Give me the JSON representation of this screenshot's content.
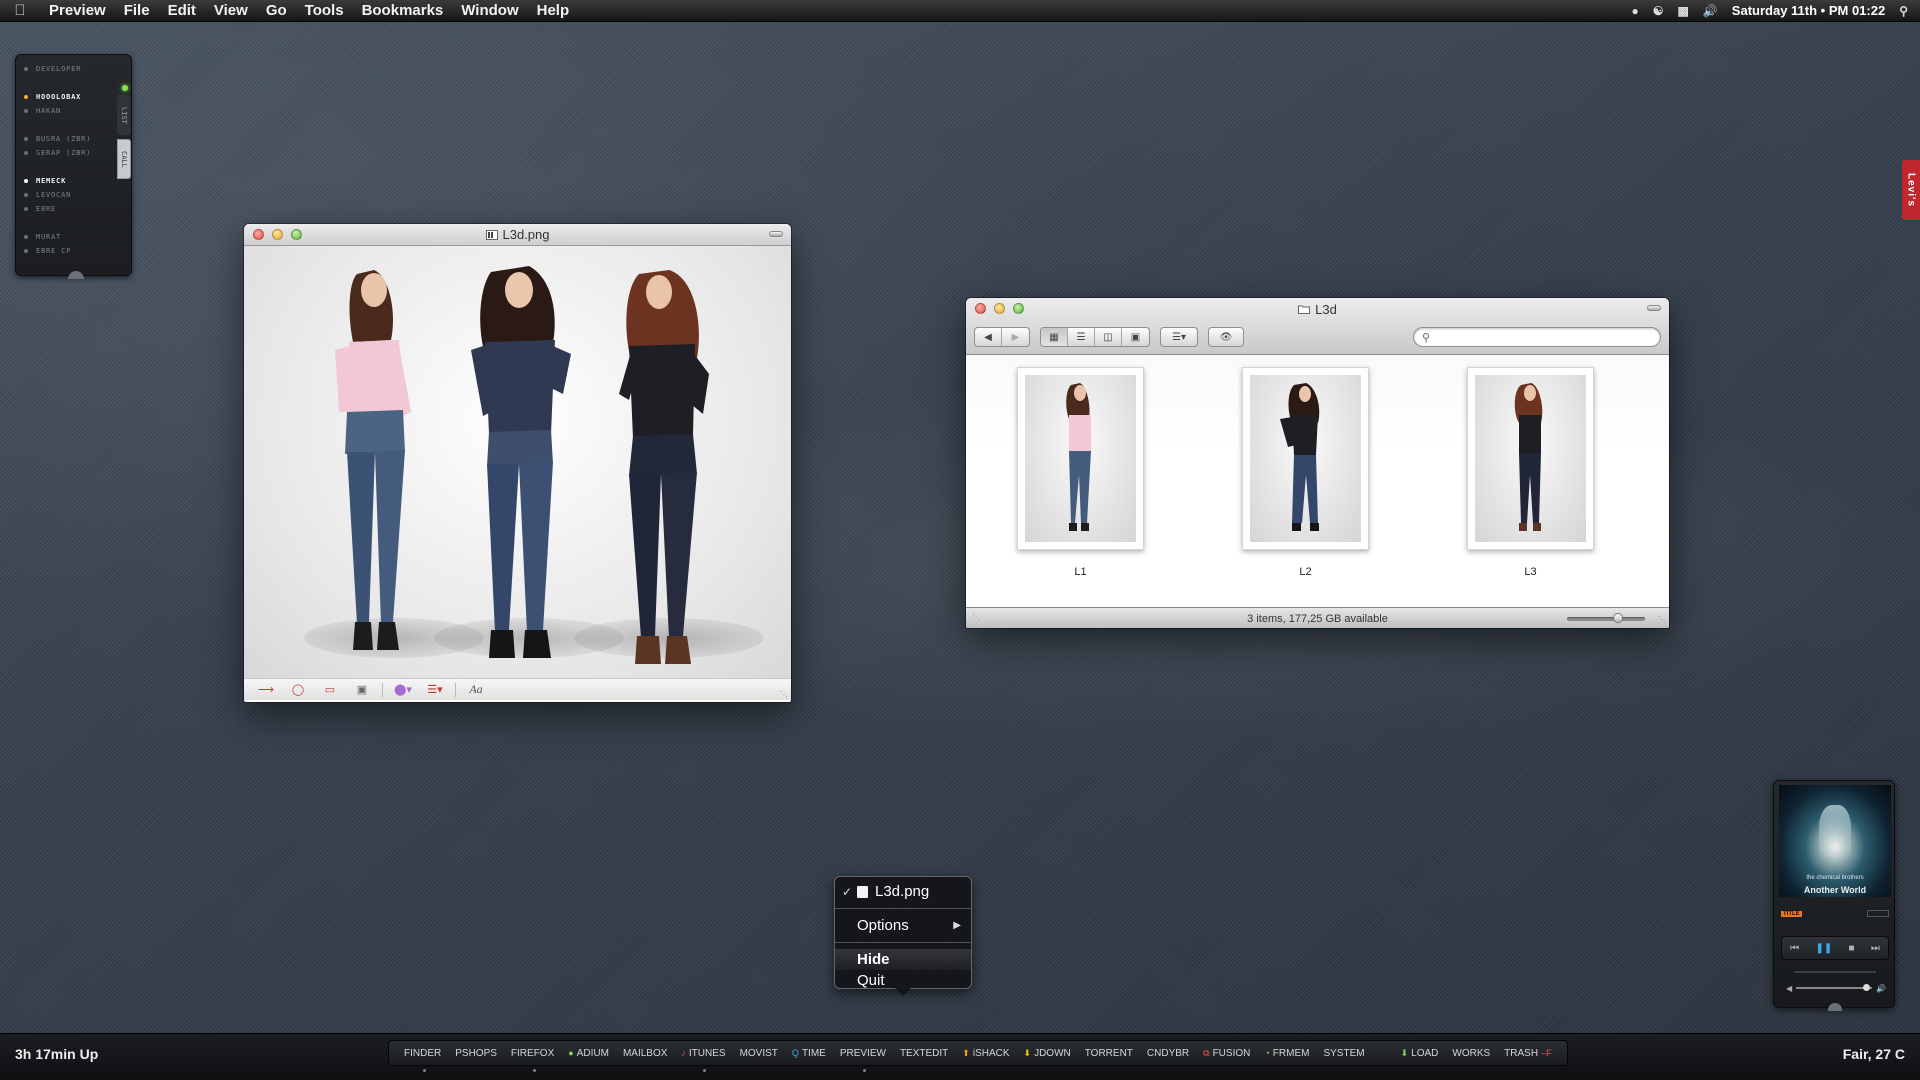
{
  "menubar": {
    "app_name": "Preview",
    "items": [
      "File",
      "Edit",
      "View",
      "Go",
      "Tools",
      "Bookmarks",
      "Window",
      "Help"
    ],
    "clock": "Saturday 11th  •  PM 01:22",
    "status_icons": [
      "chat-icon",
      "network-icon",
      "display-icon",
      "volume-icon",
      "spotlight-icon"
    ]
  },
  "sidebar_widget": {
    "tabs": [
      "LIST",
      "CALL"
    ],
    "groups": [
      [
        {
          "label": "DEVELOPER",
          "state": "normal"
        }
      ],
      [
        {
          "label": "HOOOLOBAX",
          "state": "online"
        },
        {
          "label": "HAKAN",
          "state": "normal"
        }
      ],
      [
        {
          "label": "BUSRA (ZBR)",
          "state": "normal"
        },
        {
          "label": "SERAP (ZBR)",
          "state": "normal"
        }
      ],
      [
        {
          "label": "MEMECK",
          "state": "active"
        },
        {
          "label": "LEVOCAN",
          "state": "normal"
        },
        {
          "label": "EBRE",
          "state": "normal"
        }
      ],
      [
        {
          "label": "MURAT",
          "state": "normal"
        },
        {
          "label": "EBRE CP",
          "state": "normal"
        }
      ]
    ]
  },
  "preview_window": {
    "title": "L3d.png",
    "annotation_tools": [
      "arrow-tool",
      "oval-tool",
      "rectangle-tool",
      "text-box-tool",
      "color-picker",
      "line-style-picker"
    ],
    "font_button": "Aa"
  },
  "finder_window": {
    "title": "L3d",
    "search_placeholder": "",
    "items": [
      {
        "name": "L1"
      },
      {
        "name": "L2"
      },
      {
        "name": "L3"
      }
    ],
    "status": "3 items, 177,25 GB available"
  },
  "dock_menu": {
    "document": "L3d.png",
    "options": "Options",
    "hide": "Hide",
    "quit": "Quit"
  },
  "music_widget": {
    "band": "the chemical brothers",
    "album": "Another World",
    "title_tag": "TITLE"
  },
  "side_tag": "Levi's",
  "bottombar": {
    "uptime": "3h 17min Up",
    "weather": "Fair, 27 C",
    "apps": [
      {
        "label": "FINDER",
        "mark": "",
        "color": "",
        "running": true
      },
      {
        "label": "PSHOPS",
        "mark": "",
        "color": "",
        "running": false
      },
      {
        "label": "FIREFOX",
        "mark": "",
        "color": "",
        "running": true
      },
      {
        "label": "ADIUM",
        "mark": "●",
        "color": "#7ed957",
        "running": false
      },
      {
        "label": "MAILBOX",
        "mark": "",
        "color": "",
        "running": false
      },
      {
        "label": "ITUNES",
        "mark": "♪",
        "color": "#e8574b",
        "running": true
      },
      {
        "label": "MOVIST",
        "mark": "",
        "color": "",
        "running": false
      },
      {
        "label": "TIME",
        "mark": "Q",
        "color": "#3da7f0",
        "running": false
      },
      {
        "label": "PREVIEW",
        "mark": "",
        "color": "",
        "running": true
      },
      {
        "label": "TEXTEDIT",
        "mark": "",
        "color": "",
        "running": false
      },
      {
        "label": "iSHACK",
        "mark": "⬆",
        "color": "#f39c12",
        "running": false
      },
      {
        "label": "JDOWN",
        "mark": "⬇",
        "color": "#f1c40f",
        "running": false
      },
      {
        "label": "TORRENT",
        "mark": "",
        "color": "",
        "running": false
      },
      {
        "label": "CNDYBR",
        "mark": "",
        "color": "",
        "running": false
      },
      {
        "label": "FUSION",
        "mark": "⧉",
        "color": "#e8574b",
        "running": false
      },
      {
        "label": "FRMEM",
        "mark": "◔",
        "color": "#7ed957",
        "running": false
      },
      {
        "label": "SYSTEM",
        "mark": "",
        "color": "",
        "running": false
      }
    ],
    "extras": [
      {
        "label": "LOAD",
        "mark": "⬇",
        "color": "#7ed957"
      },
      {
        "label": "WORKS",
        "mark": "",
        "color": ""
      },
      {
        "label": "TRASH",
        "mark": "–F",
        "color": "#e8574b"
      }
    ]
  }
}
